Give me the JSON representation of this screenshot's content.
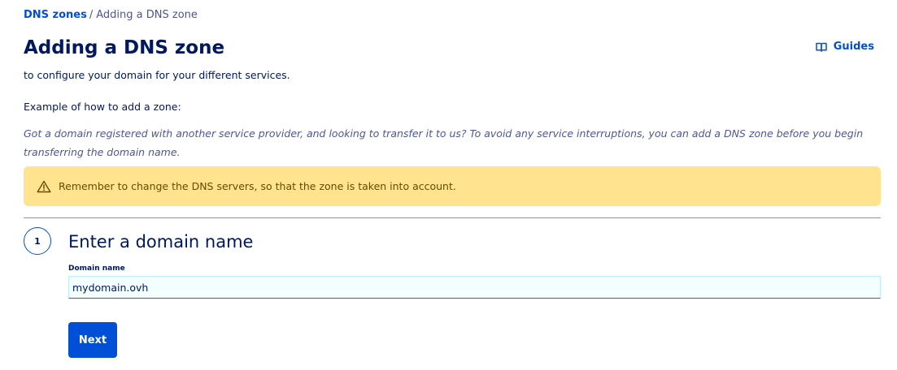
{
  "breadcrumb": {
    "parent_label": "DNS zones",
    "separator": "/",
    "current_label": "Adding a DNS zone"
  },
  "header": {
    "title": "Adding a DNS zone",
    "guides_label": "Guides",
    "guides_icon": "book-icon"
  },
  "intro": {
    "subtitle": "to configure your domain for your different services.",
    "example_heading": "Example of how to add a zone:",
    "example_text": "Got a domain registered with another service provider, and looking to transfer it to us? To avoid any service interruptions, you can add a DNS zone before you begin transferring the domain name."
  },
  "warning": {
    "icon": "warning-triangle-icon",
    "text": "Remember to change the DNS servers, so that the zone is taken into account."
  },
  "step": {
    "number": "1",
    "title": "Enter a domain name",
    "field_label": "Domain name",
    "field_value": "mydomain.ovh",
    "next_label": "Next"
  },
  "colors": {
    "primary": "#0050d7",
    "text_dark": "#00185e",
    "warning_bg": "#ffe38f",
    "input_bg": "#f2feff"
  }
}
